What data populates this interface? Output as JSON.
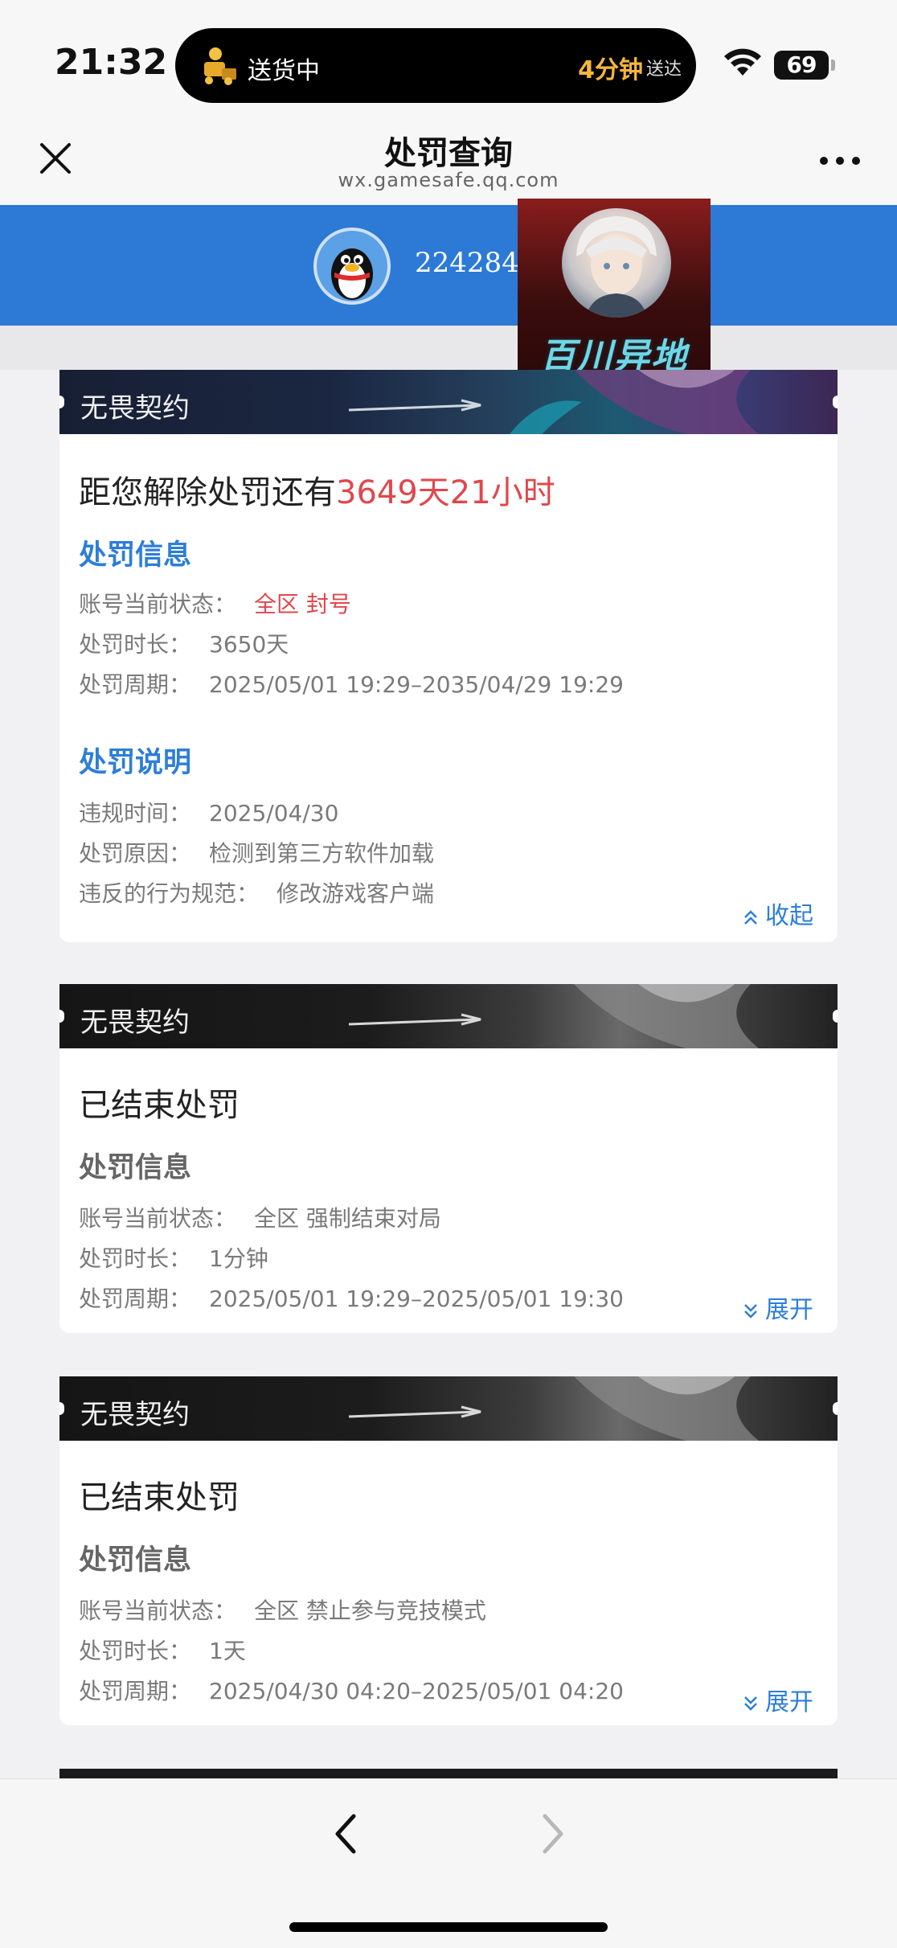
{
  "status_bar": {
    "time": "21:32",
    "delivery_status": "送货中",
    "eta_value": "4分钟",
    "eta_suffix": "送达",
    "battery": "69"
  },
  "header": {
    "title": "处罚查询",
    "domain": "wx.gamesafe.qq.com"
  },
  "account": {
    "qq_number": "2242841"
  },
  "overlay": {
    "label": "百川异地"
  },
  "cards": [
    {
      "game": "无畏契约",
      "countdown_prefix": "距您解除处罚还有",
      "countdown_value": "3649天21小时",
      "info_title": "处罚信息",
      "rows": [
        {
          "label": "账号当前状态：",
          "value": "全区 封号"
        },
        {
          "label": "处罚时长：",
          "value": "3650天"
        },
        {
          "label": "处罚周期：",
          "value": "2025/05/01 19:29–2035/04/29 19:29"
        }
      ],
      "desc_title": "处罚说明",
      "desc_rows": [
        {
          "label": "违规时间：",
          "value": "2025/04/30"
        },
        {
          "label": "处罚原因：",
          "value": "检测到第三方软件加载"
        },
        {
          "label": "违反的行为规范：",
          "value": "修改游戏客户端"
        }
      ],
      "toggle": "收起"
    },
    {
      "game": "无畏契约",
      "status": "已结束处罚",
      "info_title": "处罚信息",
      "rows": [
        {
          "label": "账号当前状态：",
          "value": "全区 强制结束对局"
        },
        {
          "label": "处罚时长：",
          "value": "1分钟"
        },
        {
          "label": "处罚周期：",
          "value": "2025/05/01 19:29–2025/05/01 19:30"
        }
      ],
      "toggle": "展开"
    },
    {
      "game": "无畏契约",
      "status": "已结束处罚",
      "info_title": "处罚信息",
      "rows": [
        {
          "label": "账号当前状态：",
          "value": "全区 禁止参与竞技模式"
        },
        {
          "label": "处罚时长：",
          "value": "1天"
        },
        {
          "label": "处罚周期：",
          "value": "2025/04/30 04:20–2025/05/01 04:20"
        }
      ],
      "toggle": "展开"
    }
  ],
  "colors": {
    "accent_blue": "#2d7ed8",
    "banner_blue": "#2c7ad6",
    "alert_red": "#e0474d"
  },
  "icons": [
    "courier-icon",
    "wifi-icon",
    "close-icon",
    "more-icon",
    "qq-penguin-icon",
    "chevron-up-icon",
    "chevron-down-icon",
    "back-arrow-icon",
    "forward-arrow-icon"
  ]
}
